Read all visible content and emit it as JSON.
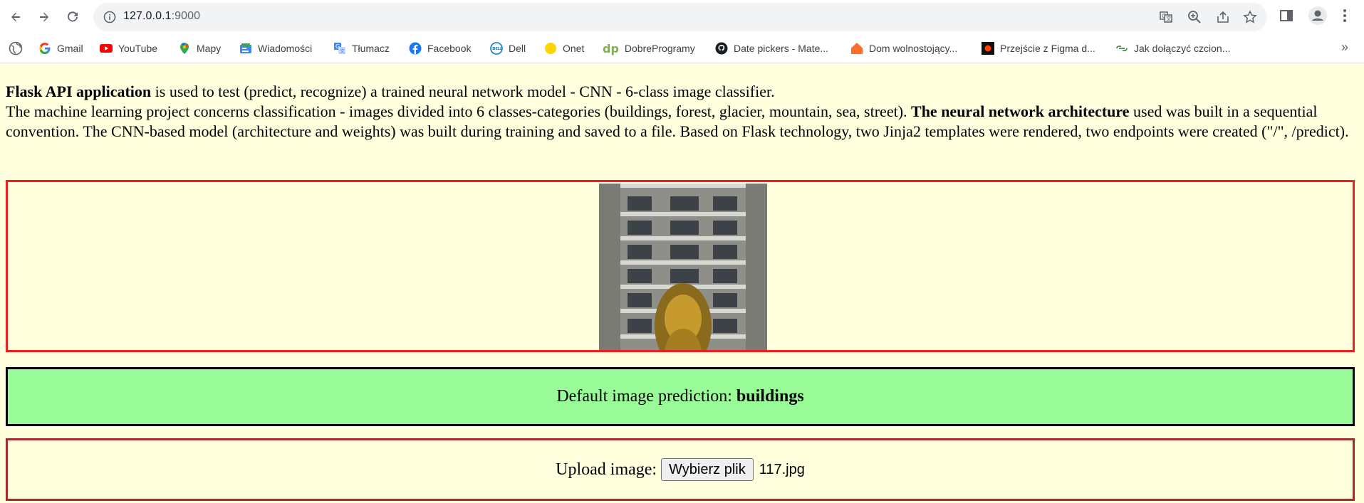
{
  "browser": {
    "url_host": "127.0.0.1",
    "url_port": ":9000",
    "bookmarks": [
      {
        "label": "Gmail",
        "icon": "google-icon"
      },
      {
        "label": "YouTube",
        "icon": "youtube-icon"
      },
      {
        "label": "Mapy",
        "icon": "maps-pin-icon"
      },
      {
        "label": "Wiadomości",
        "icon": "news-icon"
      },
      {
        "label": "Tłumacz",
        "icon": "translate-icon"
      },
      {
        "label": "Facebook",
        "icon": "facebook-icon"
      },
      {
        "label": "Dell",
        "icon": "dell-icon"
      },
      {
        "label": "Onet",
        "icon": "onet-dot-icon"
      },
      {
        "label": "DobreProgramy",
        "icon": "dp-icon"
      },
      {
        "label": "Date pickers - Mate...",
        "icon": "github-icon"
      },
      {
        "label": "Dom wolnostojący...",
        "icon": "house-icon"
      },
      {
        "label": "Przejście z Figma d...",
        "icon": "figma-dark-icon"
      },
      {
        "label": "Jak dołączyć czcion...",
        "icon": "link-chain-icon"
      }
    ],
    "more": "»"
  },
  "intro": {
    "bold_1": "Flask API application",
    "text_1": " is used to test (predict, recognize) a trained neural network model - CNN - 6-class image classifier.",
    "text_2": "The machine learning project concerns classification - images divided into 6 classes-categories (buildings, forest, glacier, mountain, sea, street). ",
    "bold_2": "The neural network architecture",
    "text_3": " used was built in a sequential convention. The CNN-based model (architecture and weights) was built during training and saved to a file. Based on Flask technology, two Jinja2 templates were rendered, two endpoints were created (\"/\", /predict)."
  },
  "prediction": {
    "label": "Default image prediction:",
    "value": "buildings"
  },
  "upload": {
    "label": "Upload image:",
    "button": "Wybierz plik",
    "filename": "117.jpg"
  }
}
